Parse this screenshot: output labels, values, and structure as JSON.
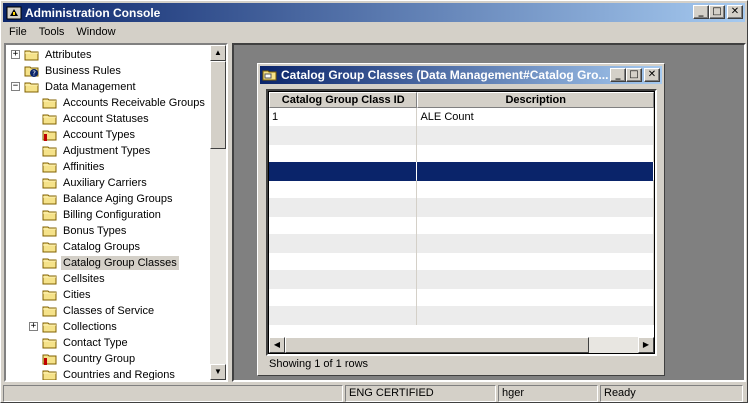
{
  "app": {
    "title": "Administration Console",
    "icon": "app-icon"
  },
  "menu": [
    "File",
    "Tools",
    "Window"
  ],
  "tree": {
    "items": [
      {
        "label": "Attributes",
        "level": 0,
        "expander": "+",
        "icon": "folder-icon"
      },
      {
        "label": "Business Rules",
        "level": 0,
        "expander": "",
        "icon": "business-rules-icon"
      },
      {
        "label": "Data Management",
        "level": 0,
        "expander": "-",
        "icon": "folder-icon"
      },
      {
        "label": "Accounts Receivable Groups",
        "level": 1,
        "expander": "",
        "icon": "folder-icon"
      },
      {
        "label": "Account Statuses",
        "level": 1,
        "expander": "",
        "icon": "folder-icon"
      },
      {
        "label": "Account Types",
        "level": 1,
        "expander": "",
        "icon": "folder-locked-icon"
      },
      {
        "label": "Adjustment Types",
        "level": 1,
        "expander": "",
        "icon": "folder-icon"
      },
      {
        "label": "Affinities",
        "level": 1,
        "expander": "",
        "icon": "folder-icon"
      },
      {
        "label": "Auxiliary Carriers",
        "level": 1,
        "expander": "",
        "icon": "folder-icon"
      },
      {
        "label": "Balance Aging Groups",
        "level": 1,
        "expander": "",
        "icon": "folder-icon"
      },
      {
        "label": "Billing Configuration",
        "level": 1,
        "expander": "",
        "icon": "folder-icon"
      },
      {
        "label": "Bonus Types",
        "level": 1,
        "expander": "",
        "icon": "folder-icon"
      },
      {
        "label": "Catalog Groups",
        "level": 1,
        "expander": "",
        "icon": "folder-icon"
      },
      {
        "label": "Catalog Group Classes",
        "level": 1,
        "expander": "",
        "icon": "folder-icon",
        "selected": true
      },
      {
        "label": "Cellsites",
        "level": 1,
        "expander": "",
        "icon": "folder-icon"
      },
      {
        "label": "Cities",
        "level": 1,
        "expander": "",
        "icon": "folder-icon"
      },
      {
        "label": "Classes of Service",
        "level": 1,
        "expander": "",
        "icon": "folder-icon"
      },
      {
        "label": "Collections",
        "level": 1,
        "expander": "+",
        "icon": "folder-icon"
      },
      {
        "label": "Contact Type",
        "level": 1,
        "expander": "",
        "icon": "folder-icon"
      },
      {
        "label": "Country Group",
        "level": 1,
        "expander": "",
        "icon": "folder-locked-icon"
      },
      {
        "label": "Countries and Regions",
        "level": 1,
        "expander": "",
        "icon": "folder-icon"
      }
    ]
  },
  "child_window": {
    "title": "Catalog Group Classes (Data Management#Catalog Gro...",
    "columns": [
      "Catalog Group Class ID",
      "Description"
    ],
    "rows": [
      [
        "1",
        "ALE Count"
      ],
      [
        "",
        ""
      ],
      [
        "",
        ""
      ],
      [
        "",
        ""
      ],
      [
        "",
        ""
      ],
      [
        "",
        ""
      ],
      [
        "",
        ""
      ],
      [
        "",
        ""
      ],
      [
        "",
        ""
      ],
      [
        "",
        ""
      ],
      [
        "",
        ""
      ],
      [
        "",
        ""
      ]
    ],
    "selected_row": 3,
    "status": "Showing 1 of 1 rows"
  },
  "statusbar": [
    "",
    "ENG CERTIFIED",
    "hger",
    "Ready"
  ],
  "colors": {
    "title_active": "#0a246a",
    "selection": "#0a246a",
    "face": "#d4d0c8"
  }
}
